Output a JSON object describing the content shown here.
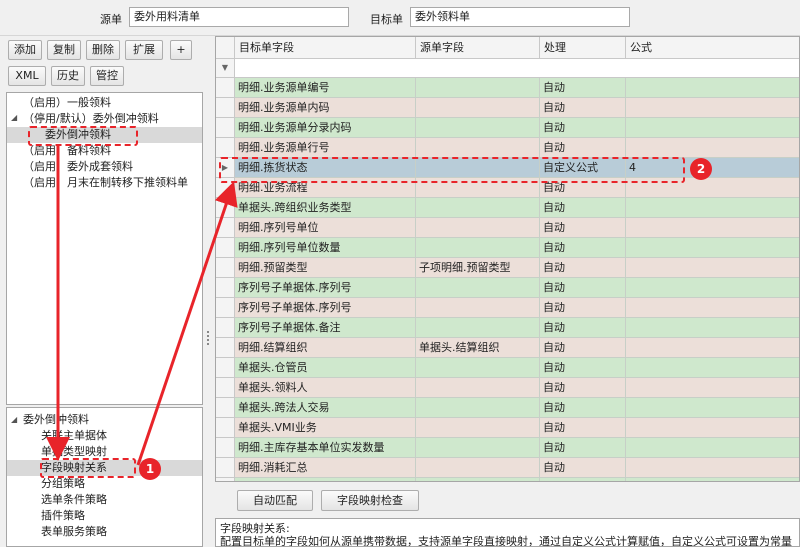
{
  "header": {
    "source_label": "源单",
    "source_value": "委外用料清单",
    "target_label": "目标单",
    "target_value": "委外领料单"
  },
  "toolbar": {
    "add": "添加",
    "copy": "复制",
    "delete": "删除",
    "expand": "扩展",
    "plus": "+",
    "xml": "XML",
    "history": "历史",
    "control": "管控"
  },
  "rules_tree": {
    "items": [
      "（启用）一般领料",
      "（停用/默认）委外倒冲领料",
      "委外倒冲领料",
      "（启用）备料领料",
      "（启用）委外成套领料",
      "（启用）月末在制转移下推领料单"
    ]
  },
  "config_tree": {
    "root": "委外倒冲领料",
    "items": [
      "关联主单据体",
      "单据类型映射",
      "字段映射关系",
      "分组策略",
      "选单条件策略",
      "插件策略",
      "表单服务策略"
    ]
  },
  "grid": {
    "columns": [
      "目标单字段",
      "源单字段",
      "处理",
      "公式"
    ],
    "rows": [
      {
        "target": "明细.业务源单编号",
        "source": "",
        "process": "自动",
        "formula": "",
        "color": "green"
      },
      {
        "target": "明细.业务源单内码",
        "source": "",
        "process": "自动",
        "formula": "",
        "color": "pink"
      },
      {
        "target": "明细.业务源单分录内码",
        "source": "",
        "process": "自动",
        "formula": "",
        "color": "green"
      },
      {
        "target": "明细.业务源单行号",
        "source": "",
        "process": "自动",
        "formula": "",
        "color": "pink"
      },
      {
        "target": "明细.拣货状态",
        "source": "",
        "process": "自定义公式",
        "formula": "4",
        "color": "sel"
      },
      {
        "target": "明细.业务流程",
        "source": "",
        "process": "自动",
        "formula": "",
        "color": "pink"
      },
      {
        "target": "单据头.跨组织业务类型",
        "source": "",
        "process": "自动",
        "formula": "",
        "color": "green"
      },
      {
        "target": "明细.序列号单位",
        "source": "",
        "process": "自动",
        "formula": "",
        "color": "pink"
      },
      {
        "target": "明细.序列号单位数量",
        "source": "",
        "process": "自动",
        "formula": "",
        "color": "green"
      },
      {
        "target": "明细.预留类型",
        "source": "子项明细.预留类型",
        "process": "自动",
        "formula": "",
        "color": "pink"
      },
      {
        "target": "序列号子单据体.序列号",
        "source": "",
        "process": "自动",
        "formula": "",
        "color": "green"
      },
      {
        "target": "序列号子单据体.序列号",
        "source": "",
        "process": "自动",
        "formula": "",
        "color": "pink"
      },
      {
        "target": "序列号子单据体.备注",
        "source": "",
        "process": "自动",
        "formula": "",
        "color": "green"
      },
      {
        "target": "明细.结算组织",
        "source": "单据头.结算组织",
        "process": "自动",
        "formula": "",
        "color": "pink"
      },
      {
        "target": "单据头.仓管员",
        "source": "",
        "process": "自动",
        "formula": "",
        "color": "green"
      },
      {
        "target": "单据头.领料人",
        "source": "",
        "process": "自动",
        "formula": "",
        "color": "pink"
      },
      {
        "target": "单据头.跨法人交易",
        "source": "",
        "process": "自动",
        "formula": "",
        "color": "green"
      },
      {
        "target": "单据头.VMI业务",
        "source": "",
        "process": "自动",
        "formula": "",
        "color": "pink"
      },
      {
        "target": "明细.主库存基本单位实发数量",
        "source": "",
        "process": "自动",
        "formula": "",
        "color": "green"
      },
      {
        "target": "明细.消耗汇总",
        "source": "",
        "process": "自动",
        "formula": "",
        "color": "pink"
      },
      {
        "target": "单据头.单据状态",
        "source": "",
        "process": "自动",
        "formula": "",
        "color": "green"
      }
    ]
  },
  "buttons": {
    "auto_match": "自动匹配",
    "field_check": "字段映射检查"
  },
  "description": {
    "title": "字段映射关系:",
    "body": "配置目标单的字段如何从源单携带数据，支持源单字段直接映射，通过自定义公式计算赋值，自定义公式可设置为常量"
  },
  "annotations": {
    "badge_1": "1",
    "badge_2": "2",
    "color": "#e8242a"
  }
}
